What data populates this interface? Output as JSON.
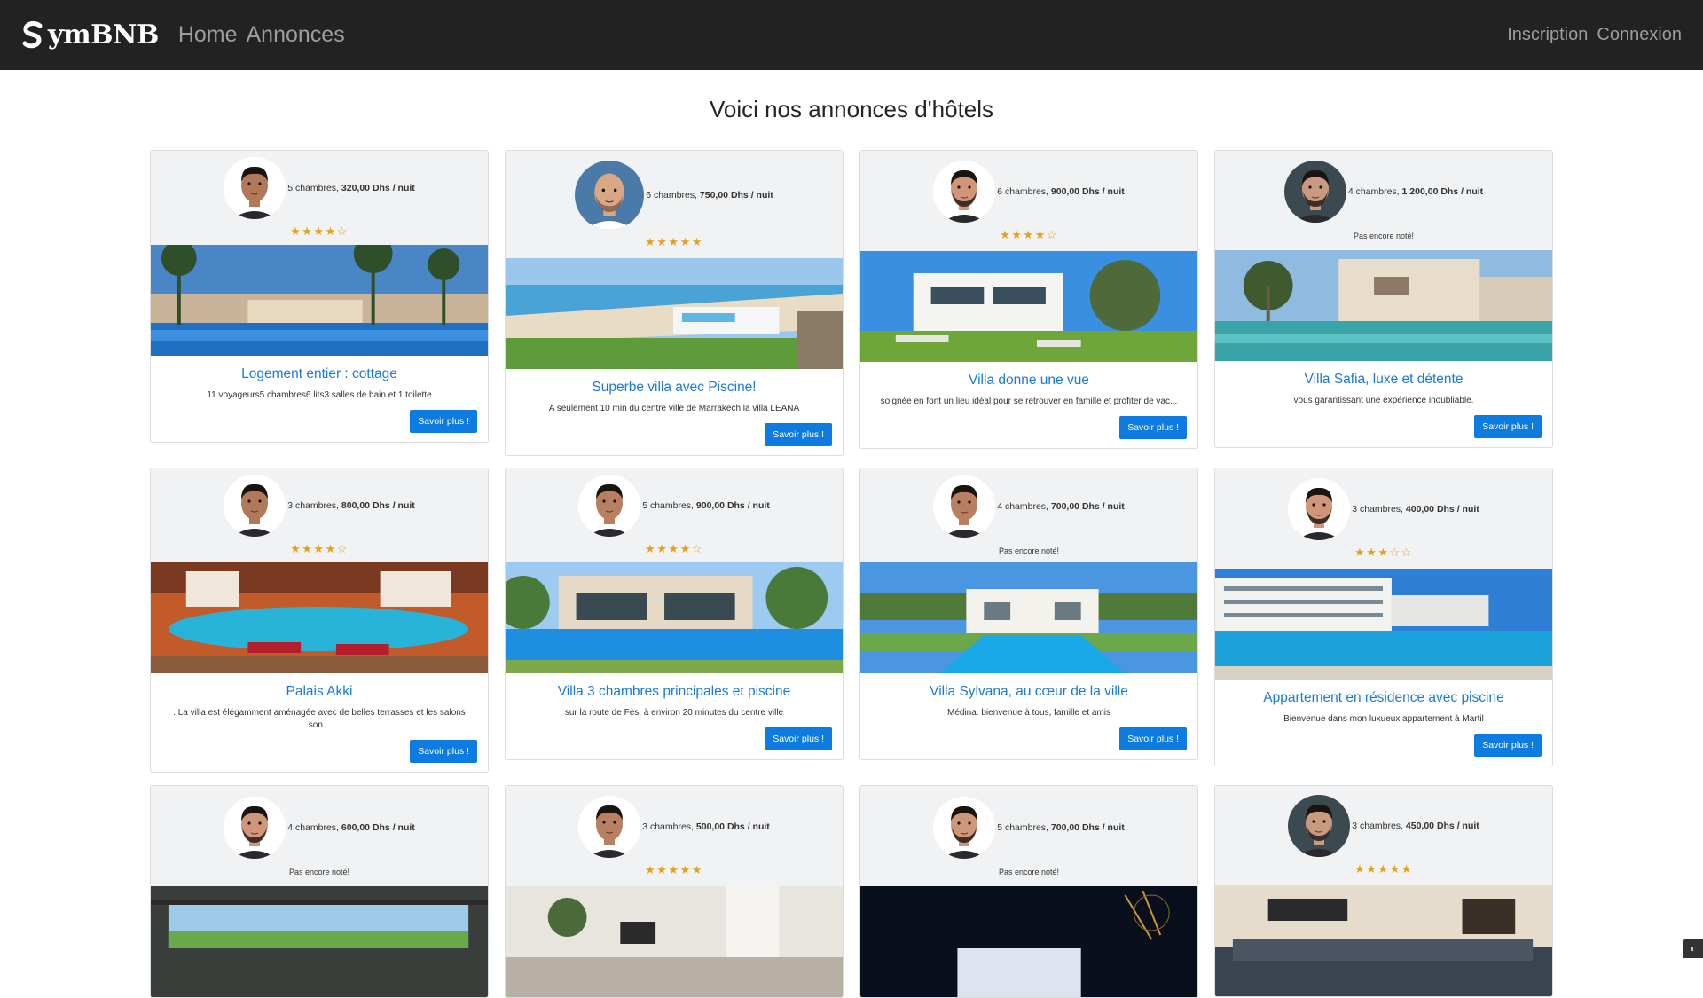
{
  "brand": {
    "name": "ymBNB"
  },
  "nav": {
    "left": [
      "Home",
      "Annonces"
    ],
    "right": [
      "Inscription",
      "Connexion"
    ]
  },
  "page": {
    "title": "Voici nos annonces d'hôtels"
  },
  "colors": {
    "navbar": "#222222",
    "link": "#1a7ad9",
    "button": "#0d7be0",
    "star": "#e3a11e",
    "card_head": "#f0f2f4"
  },
  "listings": [
    {
      "rooms": "5 chambres, ",
      "price": "320,00 Dhs / nuit",
      "rating": 4,
      "rating_text": "★★★★☆",
      "title": "Logement entier : cottage",
      "desc": "11 voyageurs5 chambres6 lits3 salles de bain et 1 toilette",
      "button": "Savoir plus !",
      "photo": "villa-pool-palms",
      "avatar": "host-1"
    },
    {
      "rooms": "6 chambres, ",
      "price": "750,00 Dhs / nuit",
      "rating": 5,
      "rating_text": "★★★★★",
      "title": "Superbe villa avec Piscine!",
      "desc": "A seulement 10 min du centre ville de Marrakech la villa LEANA",
      "button": "Savoir plus !",
      "photo": "beach-villa",
      "avatar": "host-2"
    },
    {
      "rooms": "6 chambres, ",
      "price": "900,00 Dhs / nuit",
      "rating": 4,
      "rating_text": "★★★★☆",
      "title": "Villa donne une vue",
      "desc": "soignée en font un lieu idéal pour se retrouver en famille et profiter de vac...",
      "button": "Savoir plus !",
      "photo": "modern-villa-lawn",
      "avatar": "host-3"
    },
    {
      "rooms": "4 chambres, ",
      "price": "1 200,00 Dhs / nuit",
      "rating": null,
      "rating_text": "Pas encore noté!",
      "title": "Villa Safia, luxe et détente",
      "desc": "vous garantissant une expérience inoubliable.",
      "button": "Savoir plus !",
      "photo": "pool-terrace",
      "avatar": "host-4"
    },
    {
      "rooms": "3 chambres, ",
      "price": "800,00 Dhs / nuit",
      "rating": 4,
      "rating_text": "★★★★☆",
      "title": "Palais Akki",
      "desc": ". La villa est élégamment aménagée avec de belles terrasses et les salons son...",
      "button": "Savoir plus !",
      "photo": "riad-pool",
      "avatar": "host-1"
    },
    {
      "rooms": "5 chambres, ",
      "price": "900,00 Dhs / nuit",
      "rating": 4,
      "rating_text": "★★★★☆",
      "title": "Villa 3 chambres principales et piscine",
      "desc": "sur la route de Fès, à environ 20 minutes du centre ville",
      "button": "Savoir plus !",
      "photo": "villa-pool-garden",
      "avatar": "host-5"
    },
    {
      "rooms": "4 chambres, ",
      "price": "700,00 Dhs / nuit",
      "rating": null,
      "rating_text": "Pas encore noté!",
      "title": "Villa Sylvana, au cœur de la ville",
      "desc": "Médina. bienvenue à tous, famille et amis",
      "button": "Savoir plus !",
      "photo": "white-villa-pool",
      "avatar": "host-5"
    },
    {
      "rooms": "3 chambres, ",
      "price": "400,00 Dhs / nuit",
      "rating": 3,
      "rating_text": "★★★☆☆",
      "title": "Appartement en résidence avec piscine",
      "desc": "Bienvenue dans mon luxueux appartement à Martil",
      "button": "Savoir plus !",
      "photo": "residence-pool",
      "avatar": "host-3"
    },
    {
      "rooms": "4 chambres, ",
      "price": "600,00 Dhs / nuit",
      "rating": null,
      "rating_text": "Pas encore noté!",
      "title": "",
      "desc": "",
      "button": "",
      "photo": "living-room-view",
      "avatar": "host-3"
    },
    {
      "rooms": "3 chambres, ",
      "price": "500,00 Dhs / nuit",
      "rating": 5,
      "rating_text": "★★★★★",
      "title": "",
      "desc": "",
      "button": "",
      "photo": "apartment-interior",
      "avatar": "host-5"
    },
    {
      "rooms": "5 chambres, ",
      "price": "700,00 Dhs / nuit",
      "rating": null,
      "rating_text": "Pas encore noté!",
      "title": "",
      "desc": "",
      "button": "",
      "photo": "night-villa",
      "avatar": "host-3"
    },
    {
      "rooms": "3 chambres, ",
      "price": "450,00 Dhs / nuit",
      "rating": 5,
      "rating_text": "★★★★★",
      "title": "",
      "desc": "",
      "button": "",
      "photo": "salon-sofa",
      "avatar": "host-4"
    }
  ]
}
